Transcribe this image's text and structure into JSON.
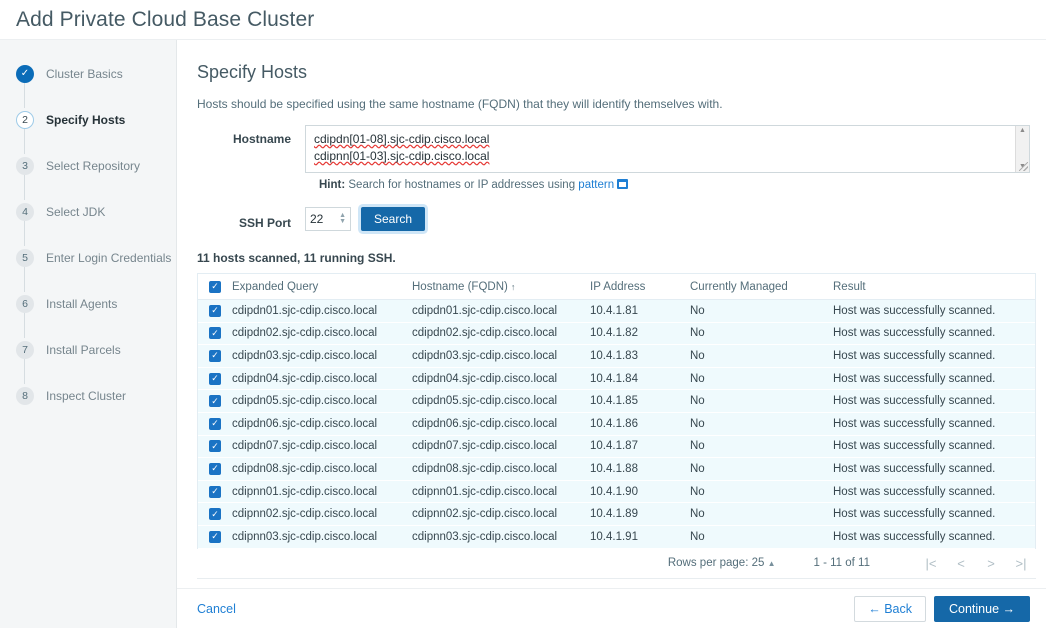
{
  "header": {
    "title": "Add Private Cloud Base Cluster"
  },
  "sidebar": {
    "steps": [
      {
        "number": "✓",
        "label": "Cluster Basics",
        "state": "done"
      },
      {
        "number": "2",
        "label": "Specify Hosts",
        "state": "current"
      },
      {
        "number": "3",
        "label": "Select Repository",
        "state": "todo"
      },
      {
        "number": "4",
        "label": "Select JDK",
        "state": "todo"
      },
      {
        "number": "5",
        "label": "Enter Login Credentials",
        "state": "todo"
      },
      {
        "number": "6",
        "label": "Install Agents",
        "state": "todo"
      },
      {
        "number": "7",
        "label": "Install Parcels",
        "state": "todo"
      },
      {
        "number": "8",
        "label": "Inspect Cluster",
        "state": "todo"
      }
    ]
  },
  "main": {
    "title": "Specify Hosts",
    "subtitle": "Hosts should be specified using the same hostname (FQDN) that they will identify themselves with.",
    "hostname": {
      "label": "Hostname",
      "line1": "cdipdn[01-08].sjc-cdip.cisco.local",
      "line2": "cdipnn[01-03].sjc-cdip.cisco.local",
      "placeholder": ""
    },
    "hint": {
      "label": "Hint:",
      "text": " Search for hostnames or IP addresses using ",
      "link": "pattern"
    },
    "ssh": {
      "label": "SSH Port",
      "value": "22",
      "search_label": "Search"
    },
    "scan_status": "11 hosts scanned, 11 running SSH.",
    "table": {
      "columns": [
        "Expanded Query",
        "Hostname (FQDN)",
        "IP Address",
        "Currently Managed",
        "Result"
      ],
      "sort_column": "Hostname (FQDN)",
      "sort_arrow": "↑",
      "rows": [
        {
          "checked": true,
          "query": "cdipdn01.sjc-cdip.cisco.local",
          "fqdn": "cdipdn01.sjc-cdip.cisco.local",
          "ip": "10.4.1.81",
          "managed": "No",
          "result": "Host was successfully scanned."
        },
        {
          "checked": true,
          "query": "cdipdn02.sjc-cdip.cisco.local",
          "fqdn": "cdipdn02.sjc-cdip.cisco.local",
          "ip": "10.4.1.82",
          "managed": "No",
          "result": "Host was successfully scanned."
        },
        {
          "checked": true,
          "query": "cdipdn03.sjc-cdip.cisco.local",
          "fqdn": "cdipdn03.sjc-cdip.cisco.local",
          "ip": "10.4.1.83",
          "managed": "No",
          "result": "Host was successfully scanned."
        },
        {
          "checked": true,
          "query": "cdipdn04.sjc-cdip.cisco.local",
          "fqdn": "cdipdn04.sjc-cdip.cisco.local",
          "ip": "10.4.1.84",
          "managed": "No",
          "result": "Host was successfully scanned."
        },
        {
          "checked": true,
          "query": "cdipdn05.sjc-cdip.cisco.local",
          "fqdn": "cdipdn05.sjc-cdip.cisco.local",
          "ip": "10.4.1.85",
          "managed": "No",
          "result": "Host was successfully scanned."
        },
        {
          "checked": true,
          "query": "cdipdn06.sjc-cdip.cisco.local",
          "fqdn": "cdipdn06.sjc-cdip.cisco.local",
          "ip": "10.4.1.86",
          "managed": "No",
          "result": "Host was successfully scanned."
        },
        {
          "checked": true,
          "query": "cdipdn07.sjc-cdip.cisco.local",
          "fqdn": "cdipdn07.sjc-cdip.cisco.local",
          "ip": "10.4.1.87",
          "managed": "No",
          "result": "Host was successfully scanned."
        },
        {
          "checked": true,
          "query": "cdipdn08.sjc-cdip.cisco.local",
          "fqdn": "cdipdn08.sjc-cdip.cisco.local",
          "ip": "10.4.1.88",
          "managed": "No",
          "result": "Host was successfully scanned."
        },
        {
          "checked": true,
          "query": "cdipnn01.sjc-cdip.cisco.local",
          "fqdn": "cdipnn01.sjc-cdip.cisco.local",
          "ip": "10.4.1.90",
          "managed": "No",
          "result": "Host was successfully scanned."
        },
        {
          "checked": true,
          "query": "cdipnn02.sjc-cdip.cisco.local",
          "fqdn": "cdipnn02.sjc-cdip.cisco.local",
          "ip": "10.4.1.89",
          "managed": "No",
          "result": "Host was successfully scanned."
        },
        {
          "checked": true,
          "query": "cdipnn03.sjc-cdip.cisco.local",
          "fqdn": "cdipnn03.sjc-cdip.cisco.local",
          "ip": "10.4.1.91",
          "managed": "No",
          "result": "Host was successfully scanned."
        }
      ]
    },
    "pagination": {
      "rows_per_page_label": "Rows per page: 25",
      "range": "1 - 11 of 11",
      "first": "|<",
      "prev": "<",
      "next": ">",
      "last": ">|"
    }
  },
  "footer": {
    "cancel": "Cancel",
    "back": "← Back",
    "continue": "Continue →"
  },
  "colors": {
    "accent": "#1568a8",
    "link": "#1f7fd4",
    "row_bg": "#effafd",
    "checkbox": "#1a73c4"
  }
}
